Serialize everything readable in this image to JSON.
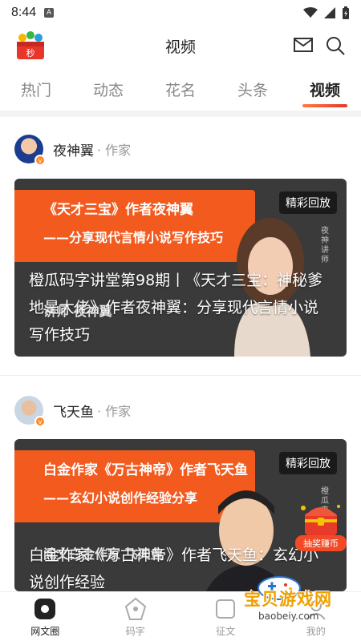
{
  "status_bar": {
    "time": "8:44",
    "a_icon": "A"
  },
  "header": {
    "title": "视频"
  },
  "tabs": [
    {
      "label": "热门"
    },
    {
      "label": "动态"
    },
    {
      "label": "花名"
    },
    {
      "label": "头条"
    },
    {
      "label": "视频",
      "active": true
    }
  ],
  "posts": [
    {
      "author_name": "夜神翼",
      "author_role": "· 作家",
      "banner_line1": "《天才三宝》作者夜神翼",
      "banner_line2": "——分享现代言情小说写作技巧",
      "tag": "精彩回放",
      "caption": "讲师 夜神翼",
      "side_text": "夜神 讲师",
      "overlay_title": "橙瓜码字讲堂第98期丨《天才三宝：神秘爹地是大佬》作者夜神翼：分享现代言情小说写作技巧"
    },
    {
      "author_name": "飞天鱼",
      "author_role": "· 作家",
      "banner_line1": "白金作家《万古神帝》作者飞天鱼",
      "banner_line2": "——玄幻小说创作经验分享",
      "tag": "精彩回放",
      "caption": "阅文白金作家 飞天鱼",
      "side_text": "橙瓜 直播",
      "overlay_title": "白金作家《万古神帝》作者飞天鱼：玄幻小说创作经验"
    }
  ],
  "prize": {
    "label": "抽奖赚币"
  },
  "watermark": {
    "text": "宝贝游戏网",
    "url": "baobeiy.com"
  },
  "bottom_nav": [
    {
      "label": "网文圈",
      "active": true
    },
    {
      "label": "码字"
    },
    {
      "label": "征文"
    },
    {
      "label": "我的"
    }
  ],
  "colors": {
    "accent": "#f25a1e",
    "tab_underline": "#e8362a"
  }
}
